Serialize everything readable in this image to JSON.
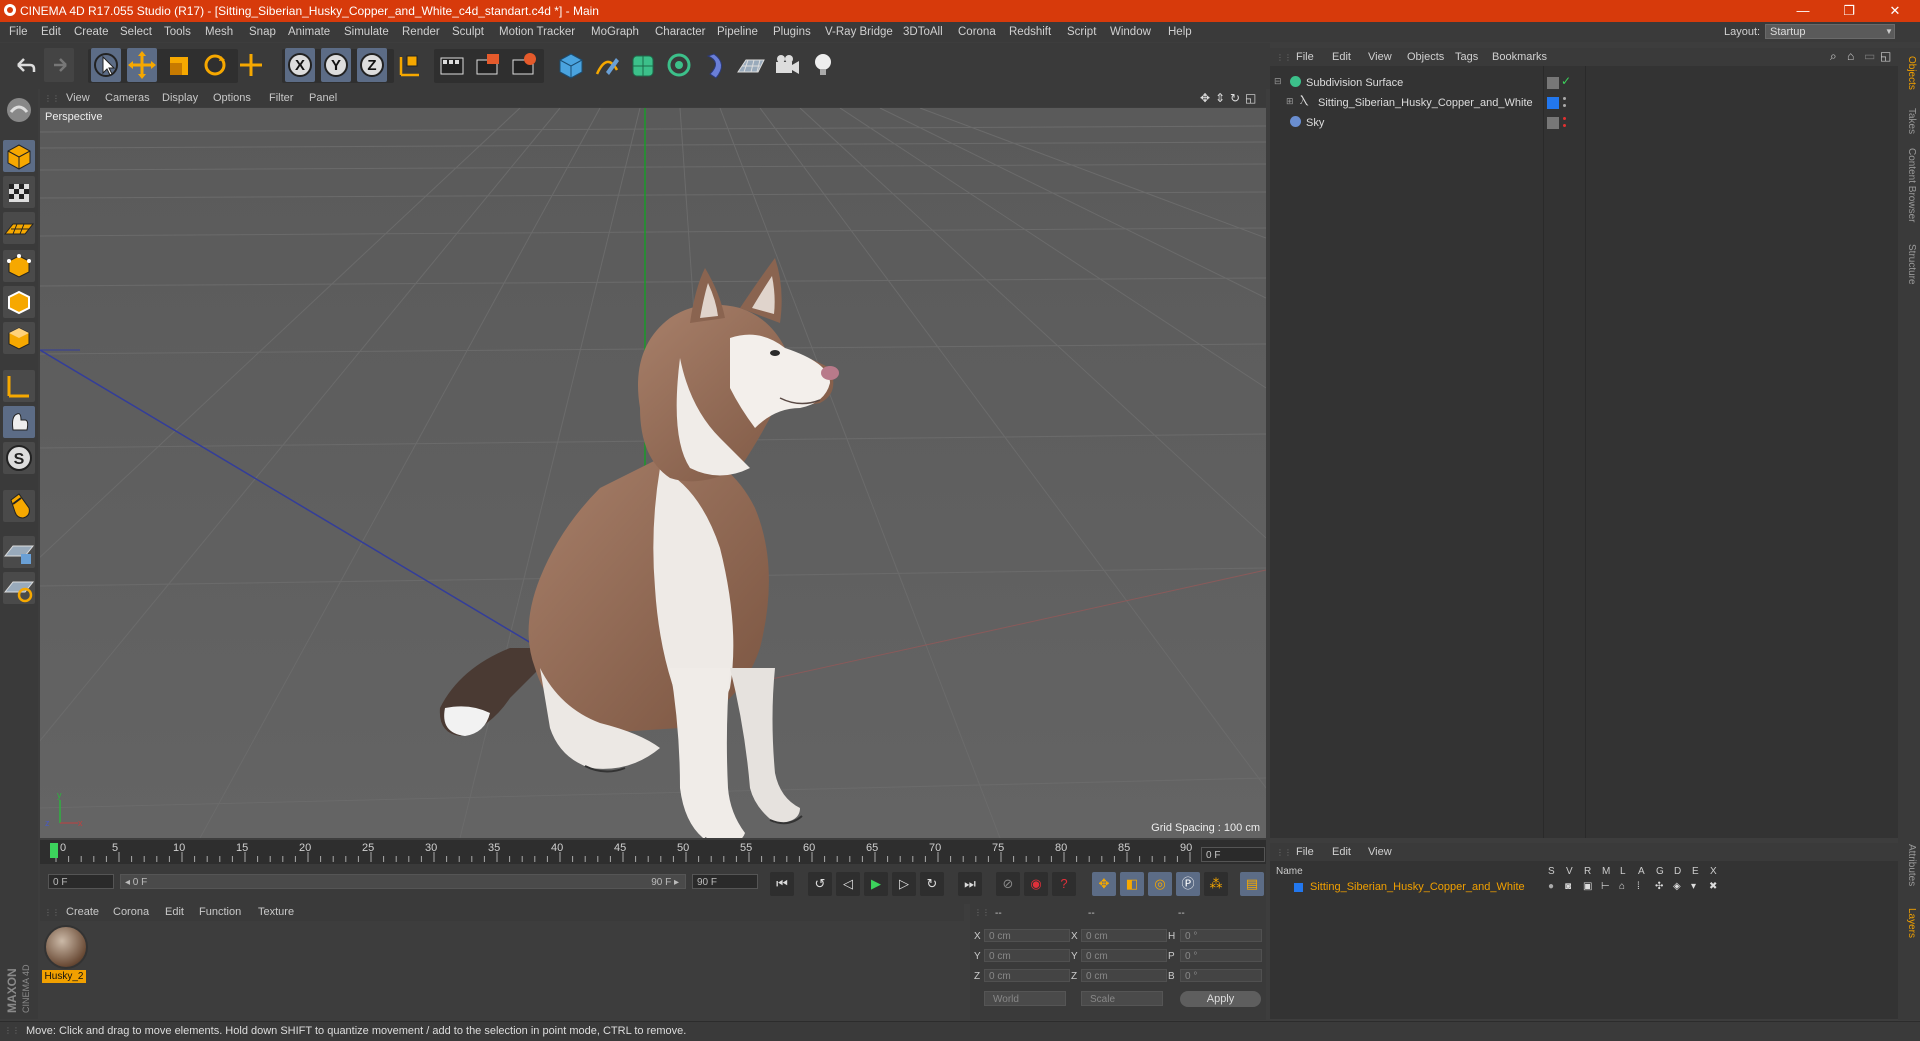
{
  "window": {
    "title": "CINEMA 4D R17.055 Studio (R17) - [Sitting_Siberian_Husky_Copper_and_White_c4d_standart.c4d *] - Main",
    "minimize_glyph": "—",
    "restore_glyph": "❐",
    "close_glyph": "✕"
  },
  "menubar": {
    "items": [
      "File",
      "Edit",
      "Create",
      "Select",
      "Tools",
      "Mesh",
      "Snap",
      "Animate",
      "Simulate",
      "Render",
      "Sculpt",
      "Motion Tracker",
      "MoGraph",
      "Character",
      "Pipeline",
      "Plugins",
      "V-Ray Bridge",
      "3DToAll",
      "Corona",
      "Redshift",
      "Script",
      "Window",
      "Help"
    ],
    "layout_label": "Layout:",
    "layout_value": "Startup"
  },
  "toolbar": {
    "axis_x": "X",
    "axis_y": "Y",
    "axis_z": "Z",
    "icons": [
      "undo-icon",
      "redo-icon",
      "select-icon",
      "move-icon",
      "scale-icon",
      "rotate-icon",
      "transform-icon",
      "axis-x-icon",
      "axis-y-icon",
      "axis-z-icon",
      "world-coordinates-icon",
      "render-view-icon",
      "render-picture-viewer-icon",
      "render-settings-icon",
      "cube-icon",
      "pen-icon",
      "subdivision-icon",
      "array-icon",
      "deformer-icon",
      "floor-icon",
      "camera-icon",
      "light-icon"
    ]
  },
  "viewport": {
    "menus": [
      "View",
      "Cameras",
      "Display",
      "Options",
      "Filter",
      "Panel"
    ],
    "label": "Perspective",
    "grid_spacing": "Grid Spacing : 100 cm"
  },
  "timeline": {
    "ticks": [
      "0",
      "5",
      "10",
      "15",
      "20",
      "25",
      "30",
      "35",
      "40",
      "45",
      "50",
      "55",
      "60",
      "65",
      "70",
      "75",
      "80",
      "85",
      "90"
    ],
    "current_frame": "0 F",
    "start_frame": "0 F",
    "range_start": "◂ 0 F",
    "range_end": "90 F ▸",
    "end_frame": "90 F"
  },
  "material_manager": {
    "menus": [
      "Create",
      "Corona",
      "Edit",
      "Function",
      "Texture"
    ],
    "material_name": "Husky_2"
  },
  "coordinates": {
    "header_dashes": [
      "--",
      "--",
      "--"
    ],
    "pos_label_x": "X",
    "pos_label_y": "Y",
    "pos_label_z": "Z",
    "size_label_x": "X",
    "size_label_y": "Y",
    "size_label_z": "Z",
    "rot_label_h": "H",
    "rot_label_p": "P",
    "rot_label_b": "B",
    "pos_x": "0 cm",
    "pos_y": "0 cm",
    "pos_z": "0 cm",
    "size_x": "0 cm",
    "size_y": "0 cm",
    "size_z": "0 cm",
    "rot_h": "0 °",
    "rot_p": "0 °",
    "rot_b": "0 °",
    "space_option": "World",
    "mode_option": "Scale",
    "apply_label": "Apply"
  },
  "object_manager": {
    "menus": [
      "File",
      "Edit",
      "View",
      "Objects",
      "Tags",
      "Bookmarks"
    ],
    "objects": [
      {
        "name": "Subdivision Surface"
      },
      {
        "name": "Sitting_Siberian_Husky_Copper_and_White"
      },
      {
        "name": "Sky"
      }
    ]
  },
  "layer_manager": {
    "menus": [
      "File",
      "Edit",
      "View"
    ],
    "col_name": "Name",
    "col_flags": [
      "S",
      "V",
      "R",
      "M",
      "L",
      "A",
      "G",
      "D",
      "E",
      "X"
    ],
    "layer_name": "Sitting_Siberian_Husky_Copper_and_White"
  },
  "right_tabs": [
    "Objects",
    "Takes",
    "Content Browser",
    "Structure",
    "Attributes",
    "Layers"
  ],
  "status": {
    "text": "Move: Click and drag to move elements. Hold down SHIFT to quantize movement / add to the selection in point mode, CTRL to remove."
  },
  "branding": {
    "logo_top": "MAXON",
    "logo_bottom": "CINEMA 4D"
  },
  "colors": {
    "titlebar": "#d73a0b",
    "accent_orange": "#f1a000",
    "selection_blue": "#5c6c86",
    "layer_blue": "#2277ee"
  }
}
